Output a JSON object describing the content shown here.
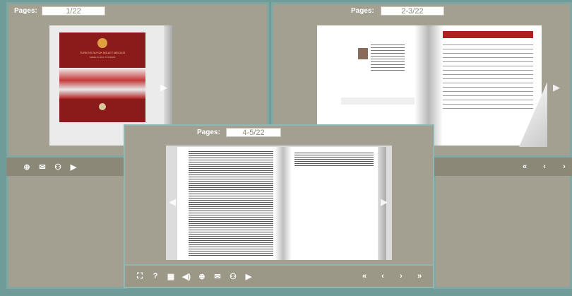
{
  "panels": {
    "left": {
      "pages_label": "Pages:",
      "page_value": "1/22"
    },
    "right": {
      "pages_label": "Pages:",
      "page_value": "2-3/22"
    },
    "front": {
      "pages_label": "Pages:",
      "page_value": "4-5/22"
    }
  },
  "toolbar_left": {
    "icons": [
      "zoom-in-icon",
      "email-icon",
      "share-icon",
      "play-icon"
    ],
    "glyphs": [
      "⊕",
      "✉",
      "⚇",
      "▶"
    ]
  },
  "toolbar_right": {
    "glyphs": [
      "«",
      "‹",
      "›"
    ]
  },
  "toolbar_front": {
    "left_glyphs": [
      "⛶",
      "?",
      "▦",
      "◀)",
      "⊕",
      "✉",
      "⚇",
      "▶"
    ],
    "right_glyphs": [
      "«",
      "‹",
      "›",
      "»"
    ]
  },
  "cover": {
    "title": "TÜRKİYE BÜYÜK MİLLET MECLİSİ",
    "subtitle": "GENEL KURUL TUTANAĞI"
  },
  "colors": {
    "background": "#6f9c98",
    "panel": "#a39f91",
    "toolbar": "#8c8878",
    "cover_red": "#8b1a1a"
  }
}
